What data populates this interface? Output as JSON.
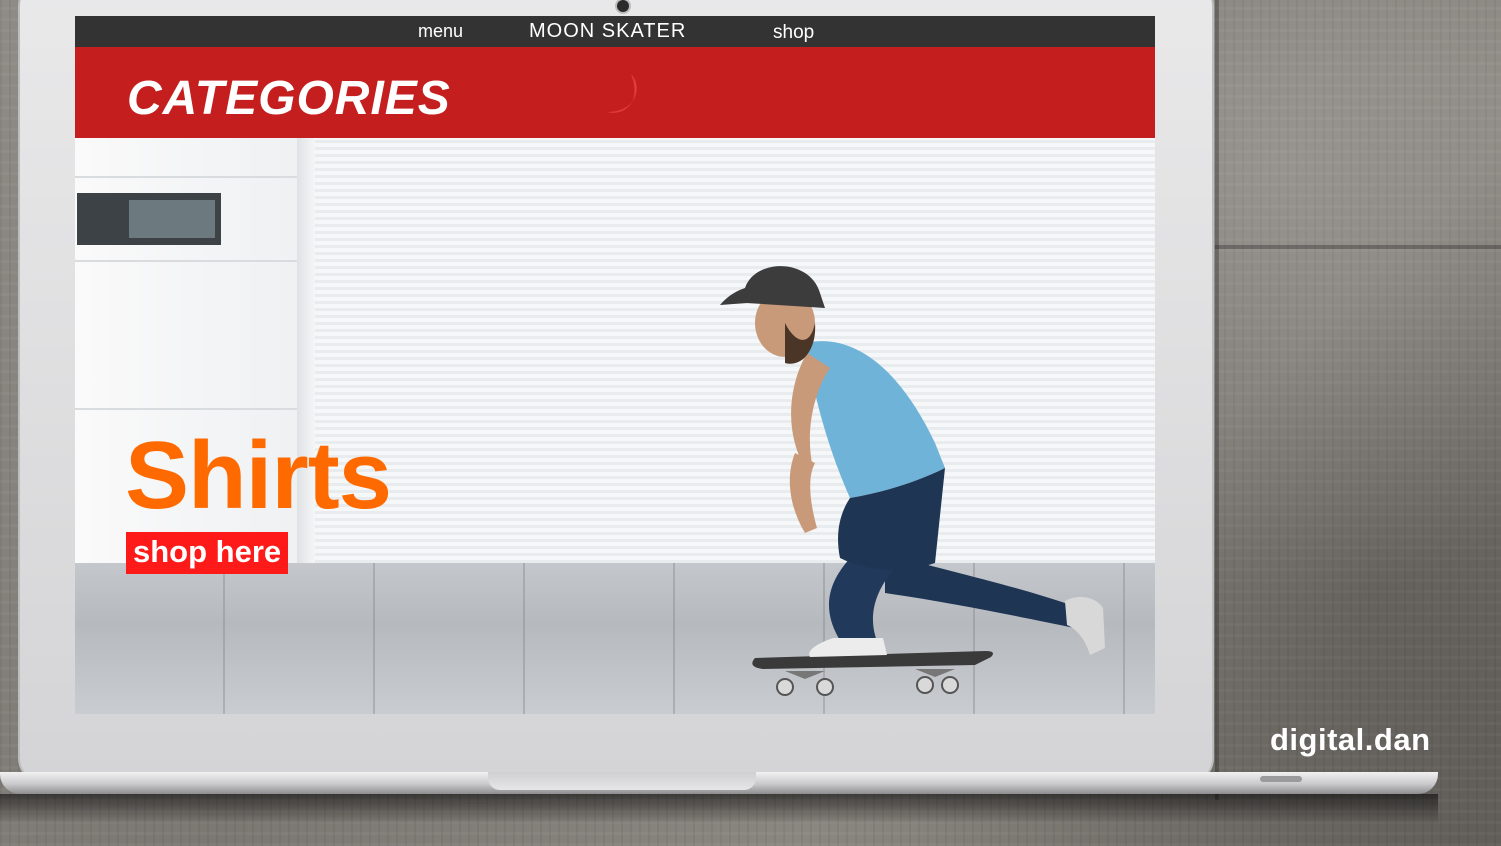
{
  "nav": {
    "menu_label": "menu",
    "logo_text": "MOON SKATER",
    "shop_label": "shop"
  },
  "banner": {
    "title": "CATEGORIES",
    "logo_icon": "crescent-moon-icon"
  },
  "hero": {
    "category_title": "Shirts",
    "cta_label": "shop here",
    "prev_icon": "chevron-left-icon",
    "next_icon": "chevron-right-icon"
  },
  "watermark": {
    "text": "digital.dan"
  },
  "colors": {
    "nav_bg": "#333333",
    "banner_bg": "#c41e1e",
    "category_title": "#ff6a00",
    "cta_bg": "#ff1a1a",
    "moon": "#e23b3b"
  }
}
